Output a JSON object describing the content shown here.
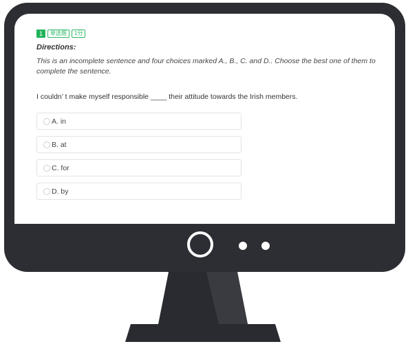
{
  "question": {
    "number": "1",
    "type_tag": "单选题",
    "score_tag": "1分",
    "directions_title": "Directions:",
    "directions_text": "This is an incomplete sentence and four choices marked A., B., C. and D.. Choose the best one of them to complete the sentence.",
    "prompt": "I couldn’ t make myself responsible ____ their attitude towards the Irish members.",
    "options": [
      {
        "label": "A. in"
      },
      {
        "label": "B. at"
      },
      {
        "label": "C. for"
      },
      {
        "label": "D. by"
      }
    ]
  },
  "colors": {
    "accent": "#21b35a",
    "monitor": "#2d2e33",
    "stand": "#2a2b30"
  },
  "icons": {
    "power": "power-button-icon",
    "indicator": "indicator-dot-icon"
  }
}
